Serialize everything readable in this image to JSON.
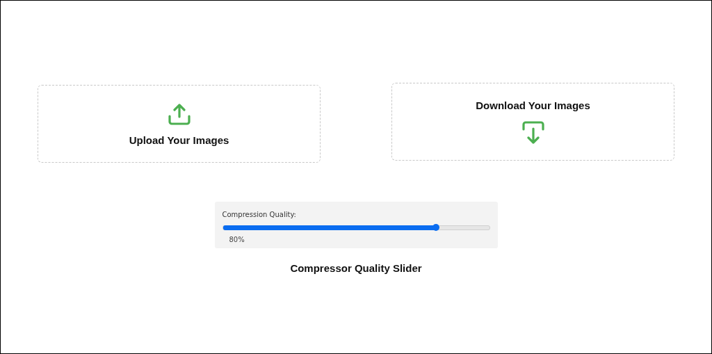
{
  "cards": [
    {
      "kind": "upload",
      "label": "Upload Your Images"
    },
    {
      "kind": "download",
      "label": "Download Your Images"
    }
  ],
  "slider": {
    "label": "Compression Quality:",
    "level": 0.8,
    "reading": "80%"
  },
  "caption": "Compressor Quality Slider"
}
